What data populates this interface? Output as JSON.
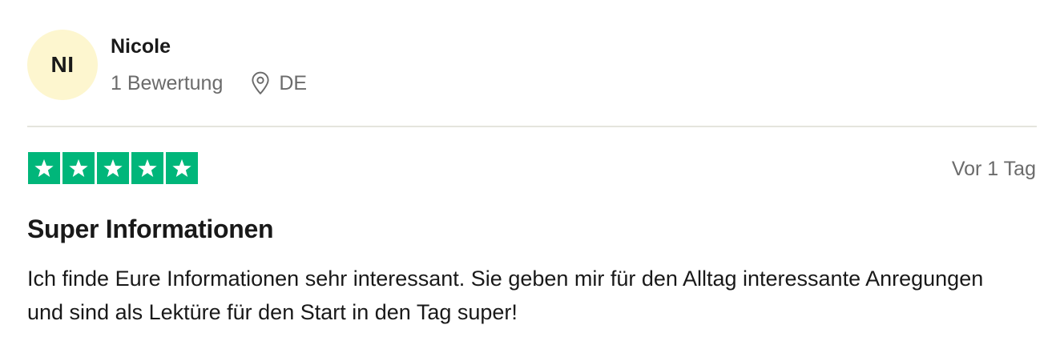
{
  "review": {
    "author": {
      "initials": "NI",
      "name": "Nicole",
      "review_count": "1 Bewertung",
      "location_icon": "location-pin-icon",
      "country": "DE"
    },
    "rating": {
      "stars": 5,
      "max_stars": 5,
      "star_color": "#00b67a",
      "star_icon": "star-icon"
    },
    "date": "Vor 1 Tag",
    "title": "Super Informationen",
    "text": "Ich finde Eure Informationen sehr interessant. Sie geben mir für den Alltag interessante Anregungen und sind als Lektüre für den Start in den Tag super!"
  },
  "colors": {
    "avatar_bg": "#fdf6cf",
    "text_primary": "#191919",
    "text_secondary": "#6b6b6b",
    "divider": "#e5e5dd"
  }
}
